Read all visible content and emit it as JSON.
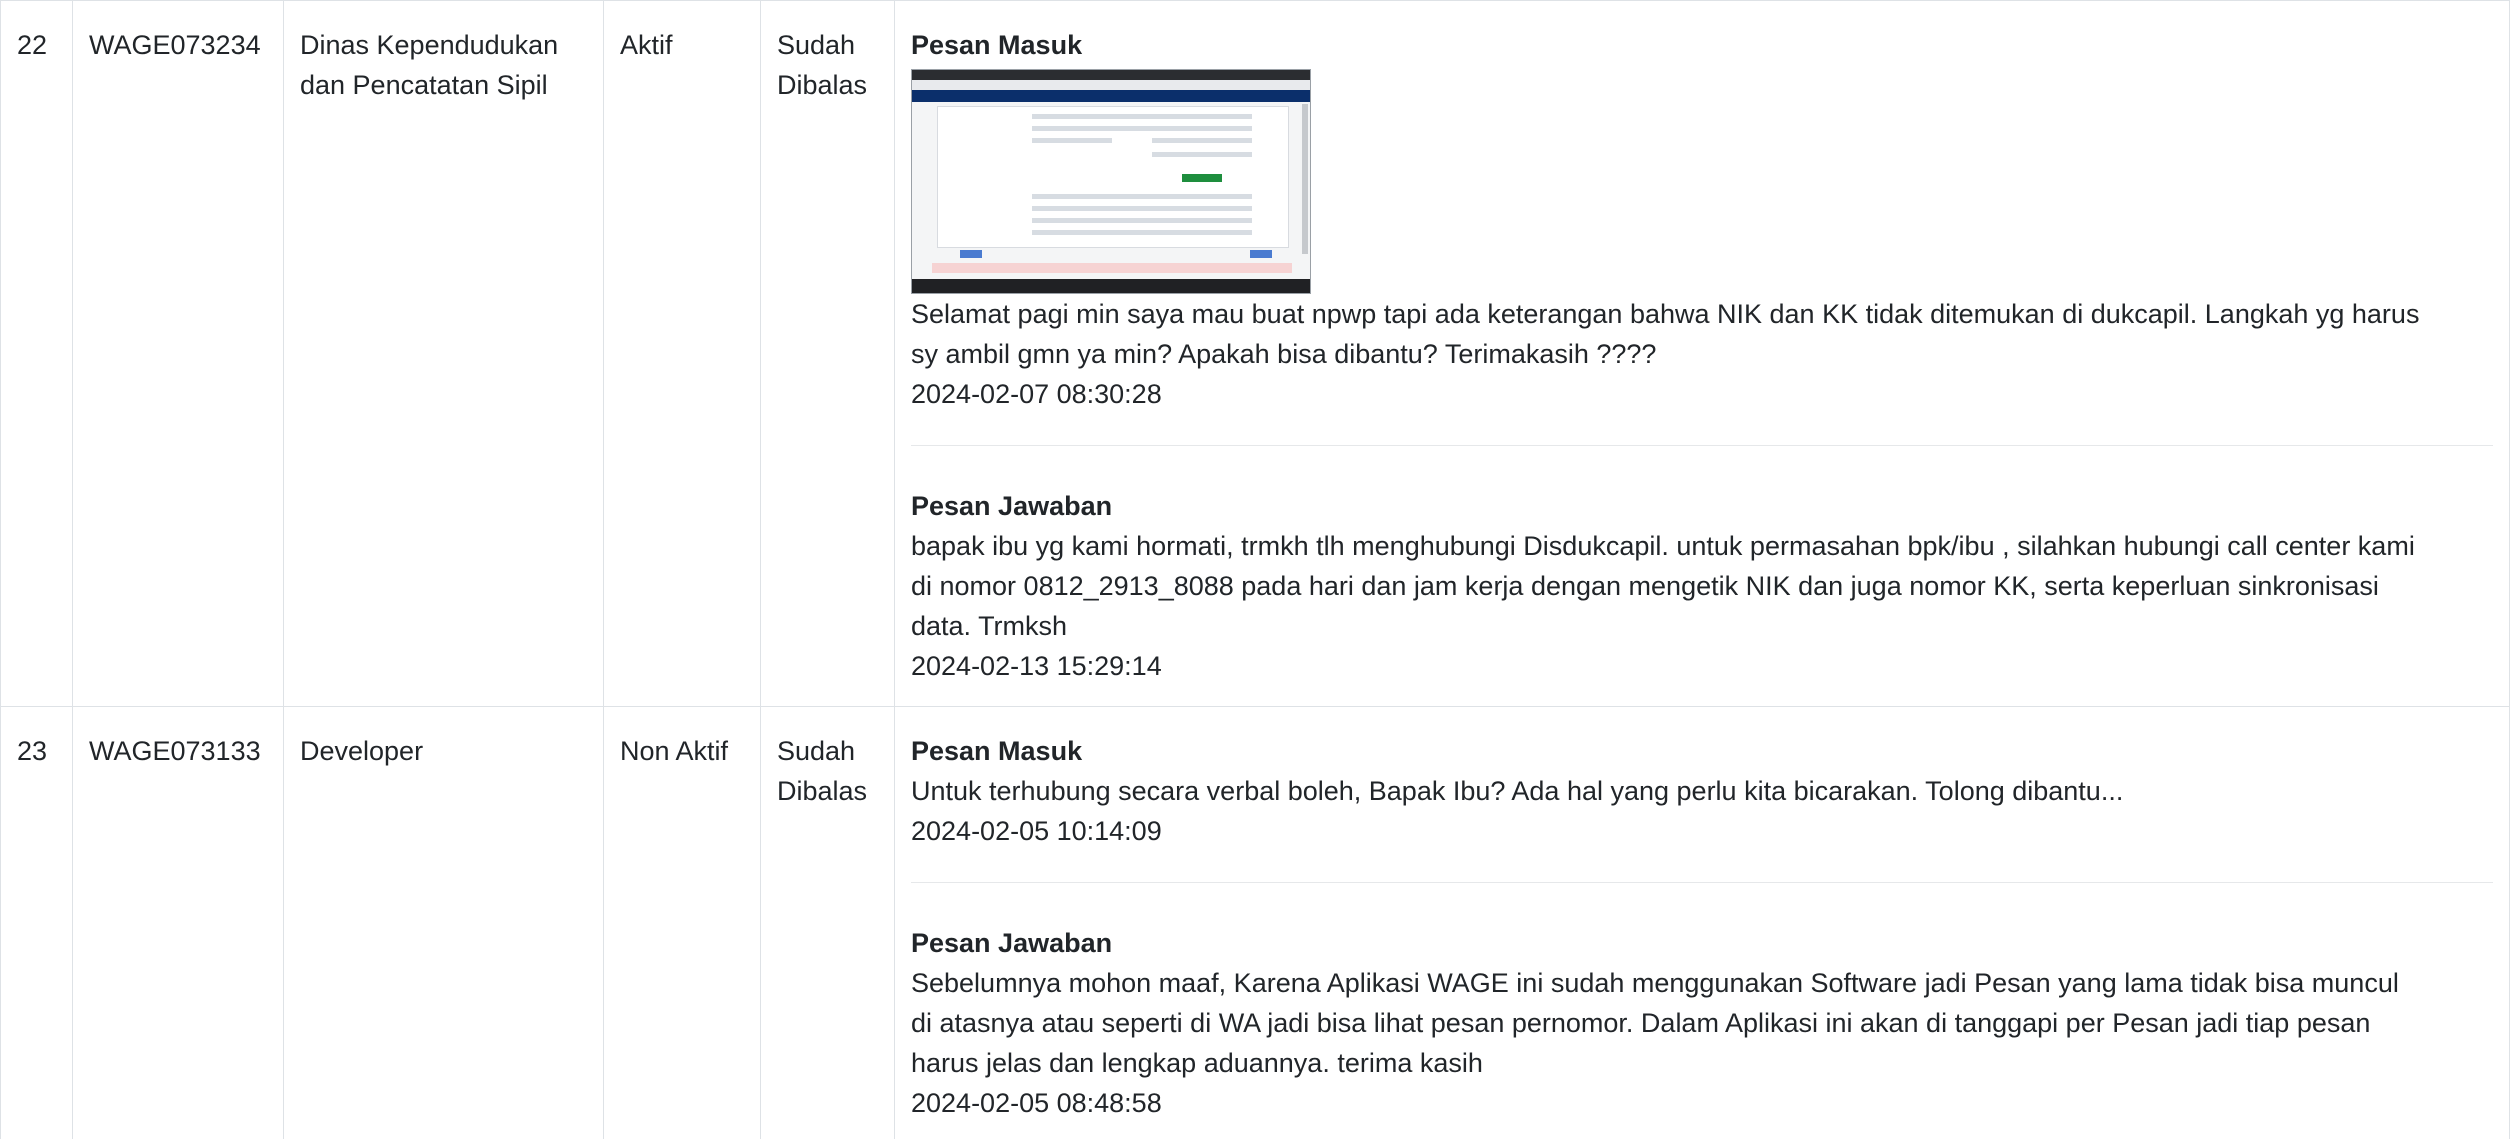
{
  "rows": [
    {
      "no": "22",
      "code": "WAGE073234",
      "agency_line1": "Dinas Kependudukan",
      "agency_line2": "dan Pencatatan Sipil",
      "status": "Aktif",
      "reply_status_line1": "Sudah",
      "reply_status_line2": "Dibalas",
      "incoming_label": "Pesan Masuk",
      "incoming_text_line1": "Selamat pagi min saya mau buat npwp tapi ada keterangan bahwa NIK dan KK tidak ditemukan di dukcapil. Langkah yg harus",
      "incoming_text_line2": "sy ambil gmn ya min? Apakah bisa dibantu? Terimakasih ????",
      "incoming_time": "2024-02-07 08:30:28",
      "reply_label": "Pesan Jawaban",
      "reply_text_line1": "bapak ibu yg kami hormati, trmkh tlh menghubungi Disdukcapil. untuk permasahan bpk/ibu , silahkan hubungi call center kami",
      "reply_text_line2": "di nomor 0812_2913_8088 pada hari dan jam kerja dengan mengetik NIK dan juga nomor KK, serta keperluan sinkronisasi",
      "reply_text_line3": "data. Trmksh",
      "reply_time": "2024-02-13 15:29:14"
    },
    {
      "no": "23",
      "code": "WAGE073133",
      "agency_line1": "Developer",
      "status": "Non Aktif",
      "reply_status_line1": "Sudah",
      "reply_status_line2": "Dibalas",
      "incoming_label": "Pesan Masuk",
      "incoming_text_line1": "Untuk terhubung secara verbal boleh, Bapak Ibu? Ada hal yang perlu kita bicarakan. Tolong dibantu...",
      "incoming_time": "2024-02-05 10:14:09",
      "reply_label": "Pesan Jawaban",
      "reply_text_line1": "Sebelumnya mohon maaf, Karena Aplikasi WAGE ini sudah menggunakan Software jadi Pesan yang lama tidak bisa muncul",
      "reply_text_line2": "di atasnya atau seperti di WA jadi bisa lihat pesan pernomor. Dalam Aplikasi ini akan di tanggapi per Pesan jadi tiap pesan",
      "reply_text_line3": "harus jelas dan lengkap aduannya. terima kasih",
      "reply_time": "2024-02-05 08:48:58"
    }
  ],
  "attachment": {
    "icon": "screenshot-thumbnail"
  }
}
